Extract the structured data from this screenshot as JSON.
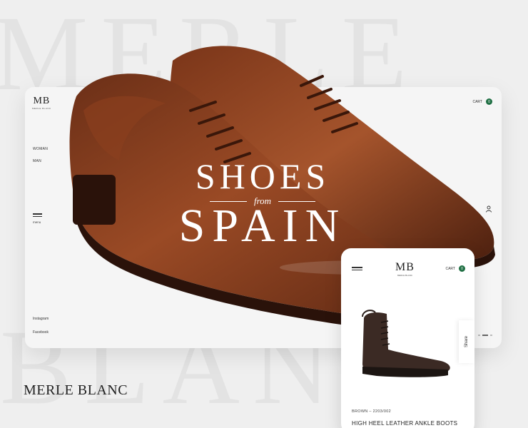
{
  "background": {
    "top_word": "MERLE",
    "bottom_word": "BLANC"
  },
  "desktop": {
    "logo": {
      "mark": "MB",
      "sub": "MERLE BLANC"
    },
    "nav": {
      "woman": "WOMAN",
      "man": "MAN"
    },
    "menu_label": "menu",
    "social": {
      "instagram": "Instagram",
      "facebook": "Facebook"
    },
    "cart": {
      "label": "CART",
      "count": "0"
    },
    "icons": {
      "user": "user-icon",
      "menu": "hamburger-icon"
    }
  },
  "hero": {
    "line1": "SHOES",
    "connector": "from",
    "line2": "SPAIN"
  },
  "mobile": {
    "logo": {
      "mark": "MB",
      "sub": "MERLE BLANC"
    },
    "cart": {
      "label": "CART",
      "count": "0"
    },
    "share_label": "Share",
    "product_meta": "BROWN – 2203/002",
    "product_name": "HIGH HEEL LEATHER ANKLE BOOTS"
  },
  "brand": {
    "wordmark": "MERLE BLANC"
  },
  "colors": {
    "accent": "#1f6f43",
    "leather": "#7a3a1d",
    "background": "#efefef"
  }
}
